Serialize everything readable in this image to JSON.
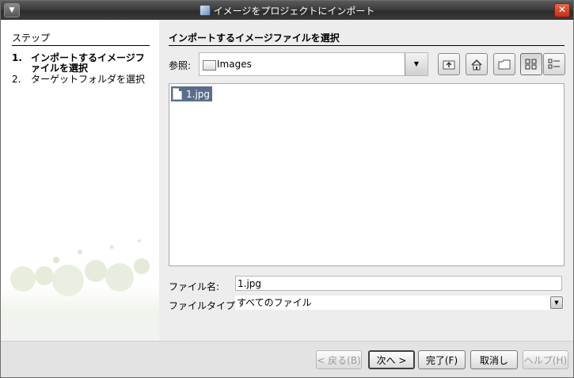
{
  "window": {
    "title": "イメージをプロジェクトにインポート"
  },
  "steps": {
    "title": "ステップ",
    "items": [
      {
        "num": "1.",
        "label": "インポートするイメージファイルを選択"
      },
      {
        "num": "2.",
        "label": "ターゲットフォルダを選択"
      }
    ]
  },
  "panel": {
    "title": "インポートするイメージファイルを選択"
  },
  "lookin": {
    "label": "参照:",
    "value": "Images"
  },
  "toolbar": {
    "up_icon": "up-folder-icon",
    "home_icon": "home-icon",
    "new_folder_icon": "new-folder-icon",
    "list_view_icon": "list-view-icon",
    "details_view_icon": "details-view-icon"
  },
  "files": [
    {
      "name": "1.jpg",
      "selected": true
    }
  ],
  "filename": {
    "label": "ファイル名:",
    "value": "1.jpg"
  },
  "filetype": {
    "label": "ファイルタイプ:",
    "value": "すべてのファイル"
  },
  "buttons": {
    "back": "< 戻る(B)",
    "next": "次へ >",
    "finish": "完了(F)",
    "cancel": "取消し",
    "help": "ヘルプ(H)"
  }
}
